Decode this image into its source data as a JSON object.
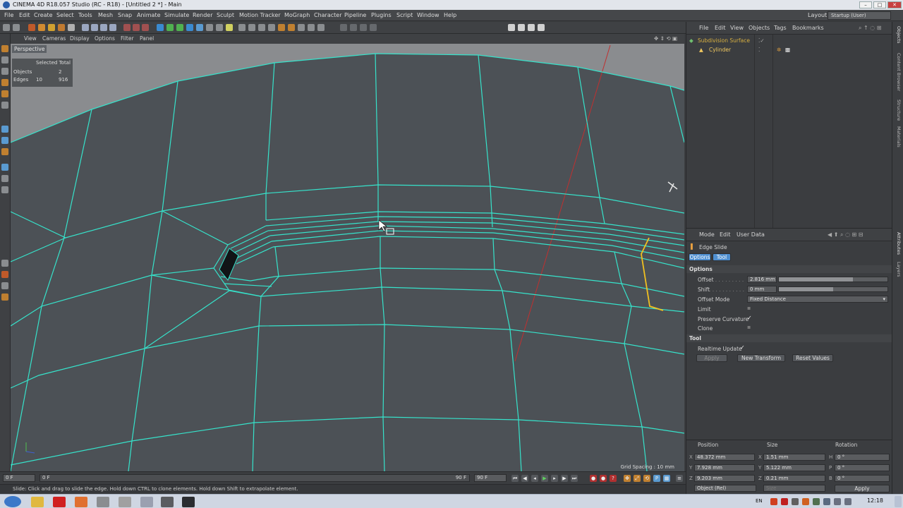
{
  "window": {
    "title": "CINEMA 4D R18.057 Studio (RC - R18) - [Untitled 2 *] - Main",
    "layout_label": "Layout:",
    "layout_value": "Startup (User)"
  },
  "menu": [
    "File",
    "Edit",
    "Create",
    "Select",
    "Tools",
    "Mesh",
    "Snap",
    "Animate",
    "Simulate",
    "Render",
    "Sculpt",
    "Motion Tracker",
    "MoGraph",
    "Character",
    "Pipeline",
    "Plugins",
    "Script",
    "Window",
    "Help"
  ],
  "viewport": {
    "menu": [
      "View",
      "Cameras",
      "Display",
      "Options",
      "Filter",
      "Panel"
    ],
    "name": "Perspective",
    "hud": {
      "header": "Selected Total",
      "objects_label": "Objects",
      "objects_total": "2",
      "edges_label": "Edges",
      "edges_selected": "10",
      "edges_total": "916"
    },
    "grid_spacing": "Grid Spacing : 10 mm",
    "colors": {
      "background": "#4c5156",
      "wire": "#34e0c8",
      "selected": "#f0c020",
      "axis": "#d03030"
    }
  },
  "timeline": {
    "start_frame": "0 F",
    "slider_start": "0 F",
    "slider_end": "90 F",
    "end_frame": "90 F"
  },
  "status": "Slide: Click and drag to slide the edge. Hold down CTRL to clone elements. Hold down Shift to extrapolate element.",
  "object_manager": {
    "menu": [
      "File",
      "Edit",
      "View",
      "Objects",
      "Tags",
      "Bookmarks"
    ],
    "objects": [
      {
        "name": "Subdivision Surface",
        "color": "#e0c040"
      },
      {
        "name": "Cylinder",
        "color": "#f0c860"
      }
    ]
  },
  "attribute_manager": {
    "menu": [
      "Mode",
      "Edit",
      "User Data"
    ],
    "tool_name": "Edge Slide",
    "tabs": [
      "Options",
      "Tool"
    ],
    "options_section": "Options",
    "fields": {
      "offset_label": "Offset",
      "offset_value": "2.816 mm",
      "offset_fill": 0.68,
      "shift_label": "Shift",
      "shift_value": "0 mm",
      "shift_fill": 0.5,
      "offset_mode_label": "Offset Mode",
      "offset_mode_value": "Fixed Distance",
      "limit_label": "Limit",
      "preserve_curvature_label": "Preserve Curvature",
      "clone_label": "Clone"
    },
    "tool_section": "Tool",
    "realtime_update_label": "Realtime Update",
    "buttons": {
      "apply": "Apply",
      "new_transform": "New Transform",
      "reset_values": "Reset Values"
    }
  },
  "coordinates": {
    "headers": [
      "Position",
      "Size",
      "Rotation"
    ],
    "rows": [
      {
        "axis_p": "X",
        "pos": "48.372 mm",
        "axis_s": "X",
        "size": "1.51 mm",
        "axis_r": "H",
        "rot": "0 °"
      },
      {
        "axis_p": "Y",
        "pos": "7.928 mm",
        "axis_s": "Y",
        "size": "5.122 mm",
        "axis_r": "P",
        "rot": "0 °"
      },
      {
        "axis_p": "Z",
        "pos": "9.203 mm",
        "axis_s": "Z",
        "size": "0.21 mm",
        "axis_r": "B",
        "rot": "0 °"
      }
    ],
    "mode": "Object (Rel)",
    "size_mode": "Size",
    "apply": "Apply"
  },
  "side_tabs": [
    "Objects",
    "Content Browser",
    "Structure",
    "Materials",
    "Attributes",
    "Layers"
  ],
  "taskbar": {
    "lang": "EN",
    "clock": "12:18"
  }
}
